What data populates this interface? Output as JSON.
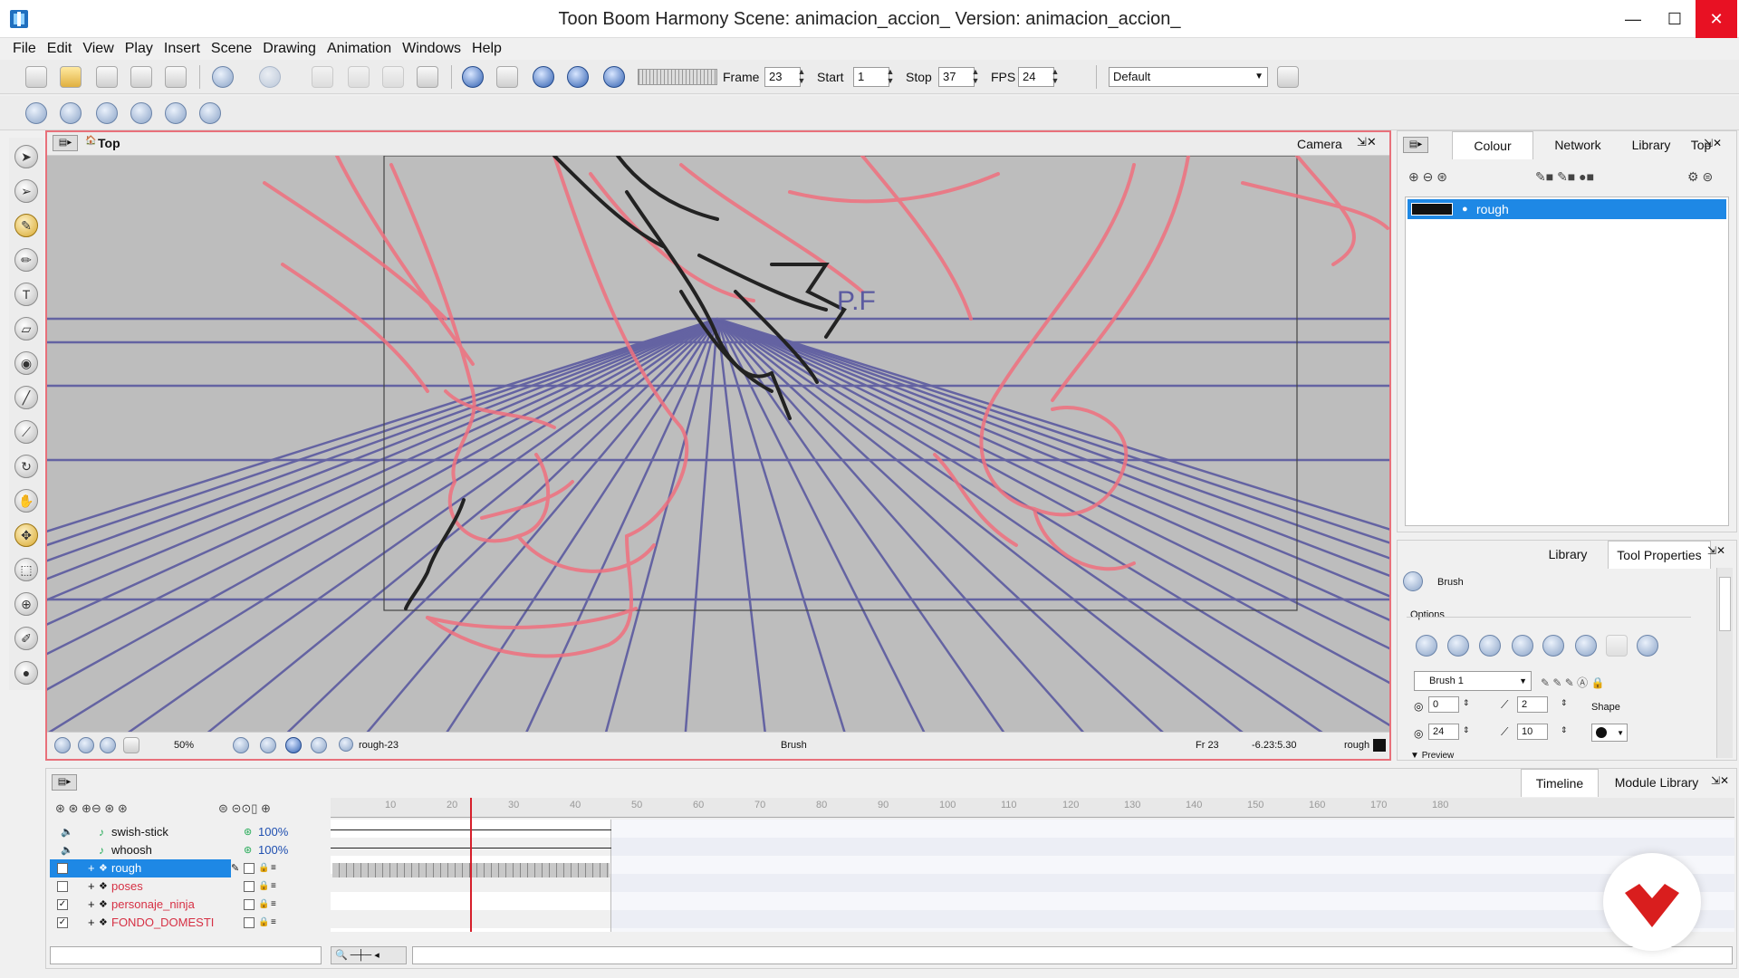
{
  "window": {
    "title": "Toon Boom Harmony Scene: animacion_accion_ Version: animacion_accion_",
    "app_icon": "toonboom-icon",
    "controls": {
      "minimize": "—",
      "maximize": "☐",
      "close": "✕"
    }
  },
  "menu": [
    "File",
    "Edit",
    "View",
    "Play",
    "Insert",
    "Scene",
    "Drawing",
    "Animation",
    "Windows",
    "Help"
  ],
  "playback": {
    "frame_label": "Frame",
    "frame_value": "23",
    "start_label": "Start",
    "start_value": "1",
    "stop_label": "Stop",
    "stop_value": "37",
    "fps_label": "FPS",
    "fps_value": "24",
    "workspace": "Default"
  },
  "view": {
    "breadcrumb": "Top",
    "camera_label": "Camera",
    "vanishing_point_label": "P.F",
    "footer": {
      "zoom": "50%",
      "drawing": "rough-23",
      "tool": "Brush",
      "frame": "Fr 23",
      "coords": "-6.23:5.30",
      "layer": "rough"
    }
  },
  "colour_panel": {
    "tabs": [
      "Colour",
      "Network",
      "Library",
      "Top"
    ],
    "active_tab": "Colour",
    "palette_item": "rough",
    "palette_color": "#111111"
  },
  "tool_properties": {
    "tabs": [
      "Library",
      "Tool Properties"
    ],
    "tool_name": "Brush",
    "options_label": "Options",
    "preset": "Brush 1",
    "min_size": "0",
    "max_size": "24",
    "smoothing": "2",
    "contour": "10",
    "shape_label": "Shape",
    "preview_label": "Preview"
  },
  "timeline": {
    "tabs": [
      "Timeline",
      "Module Library"
    ],
    "ruler": [
      "10",
      "20",
      "30",
      "40",
      "50",
      "60",
      "70",
      "80",
      "90",
      "100",
      "110",
      "120",
      "130",
      "140",
      "150",
      "160",
      "170",
      "180"
    ],
    "layers": [
      {
        "name": "swish-stick",
        "volume": "100%"
      },
      {
        "name": "whoosh",
        "volume": "100%"
      },
      {
        "name": "rough"
      },
      {
        "name": "poses"
      },
      {
        "name": "personaje_ninja"
      },
      {
        "name": "FONDO_DOMESTI"
      }
    ],
    "current_frame": 23
  },
  "colors": {
    "accent": "#1e88e5",
    "sketch": "#f0707e",
    "perspective": "#5b5aa0",
    "panel_border": "#e8707a"
  }
}
